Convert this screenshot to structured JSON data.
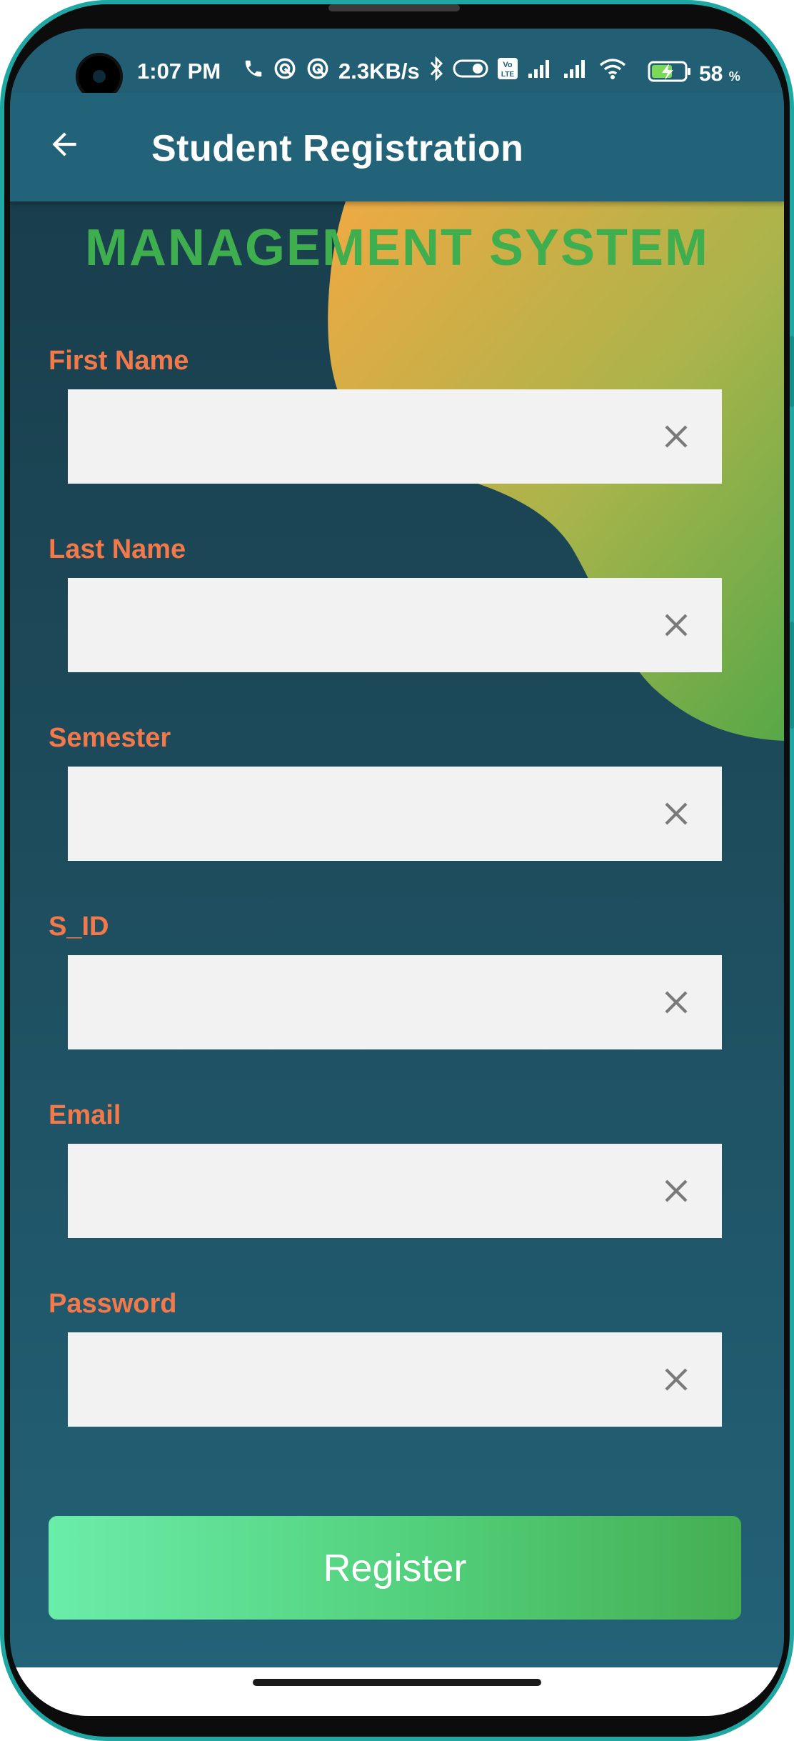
{
  "status_bar": {
    "time": "1:07 PM",
    "network_speed": "2.3KB/s",
    "battery_percent": "58",
    "battery_unit": "%",
    "icons": [
      "phone-icon",
      "hotspot-icon",
      "hotspot-icon",
      "bluetooth-icon",
      "toggle-icon",
      "volte-icon",
      "signal-icon",
      "signal-icon",
      "wifi-icon",
      "battery-charging-icon"
    ]
  },
  "app_bar": {
    "title": "Student Registration",
    "back_icon": "arrow-left-icon"
  },
  "brand": {
    "text": "MANAGEMENT SYSTEM",
    "color": "#3fae4e"
  },
  "form": {
    "fields": [
      {
        "label": "First Name",
        "value": "",
        "placeholder": ""
      },
      {
        "label": "Last Name",
        "value": "",
        "placeholder": ""
      },
      {
        "label": "Semester",
        "value": "",
        "placeholder": ""
      },
      {
        "label": "S_ID",
        "value": "",
        "placeholder": ""
      },
      {
        "label": "Email",
        "value": "",
        "placeholder": ""
      },
      {
        "label": "Password",
        "value": "",
        "placeholder": ""
      }
    ],
    "clear_icon": "close-icon",
    "label_color": "#f4794a",
    "submit_label": "Register"
  },
  "colors": {
    "app_bar": "#236379",
    "background_top": "#183a49",
    "background_bottom": "#236379",
    "accent_green": "#52cf7a",
    "accent_orange": "#f0a943"
  }
}
